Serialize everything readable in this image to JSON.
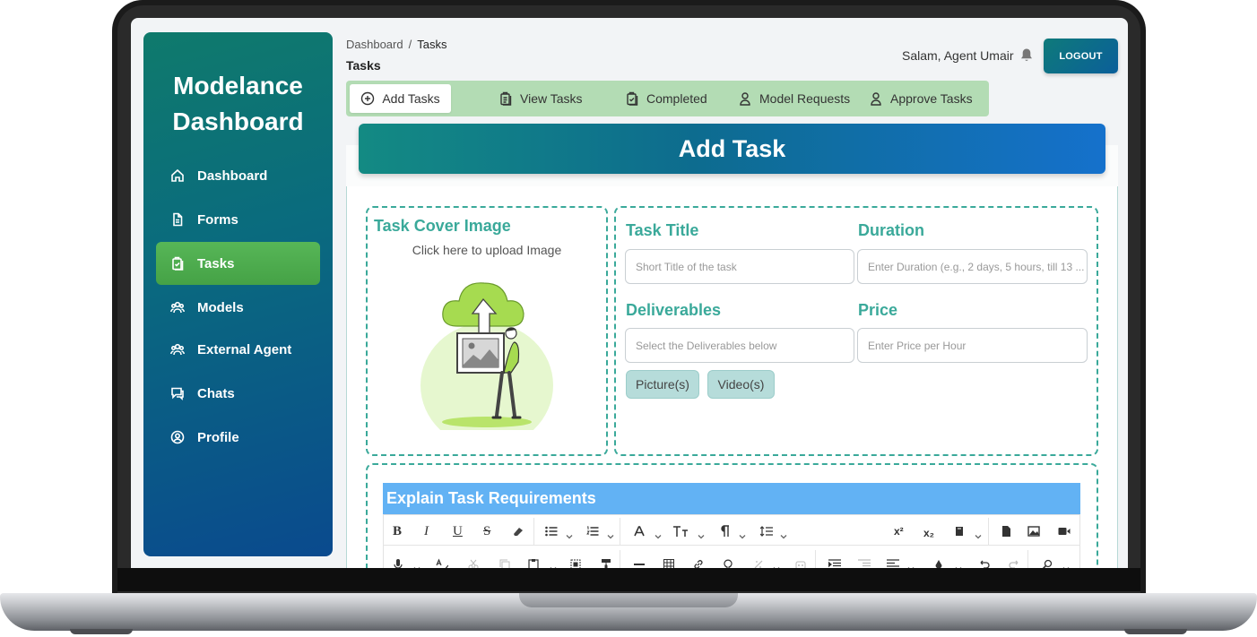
{
  "sidebar": {
    "brand_line1": "Modelance",
    "brand_line2": "Dashboard",
    "items": [
      {
        "label": "Dashboard",
        "icon": "home-icon"
      },
      {
        "label": "Forms",
        "icon": "document-icon"
      },
      {
        "label": "Tasks",
        "icon": "clipboard-check-icon",
        "active": true
      },
      {
        "label": "Models",
        "icon": "users-icon"
      },
      {
        "label": "External Agent",
        "icon": "users-icon"
      },
      {
        "label": "Chats",
        "icon": "chat-icon"
      },
      {
        "label": "Profile",
        "icon": "user-circle-icon"
      }
    ]
  },
  "header": {
    "breadcrumb_root": "Dashboard",
    "breadcrumb_sep": "/",
    "breadcrumb_current": "Tasks",
    "page_title": "Tasks",
    "greeting": "Salam, Agent Umair",
    "logout_label": "LOGOUT"
  },
  "tabs": [
    {
      "label": "Add Tasks",
      "icon": "plus-circle-icon",
      "active": true
    },
    {
      "label": "View Tasks",
      "icon": "clipboard-list-icon"
    },
    {
      "label": "Completed",
      "icon": "clipboard-check-icon"
    },
    {
      "label": "Model Requests",
      "icon": "user-icon"
    },
    {
      "label": "Approve Tasks",
      "icon": "user-icon"
    }
  ],
  "form": {
    "title": "Add Task",
    "cover": {
      "label": "Task Cover Image",
      "hint": "Click here to upload Image"
    },
    "task_title": {
      "label": "Task Title",
      "placeholder": "Short Title of the task"
    },
    "duration": {
      "label": "Duration",
      "placeholder": "Enter Duration (e.g., 2 days, 5 hours, till 13 ..."
    },
    "deliverables": {
      "label": "Deliverables",
      "placeholder": "Select the Deliverables below"
    },
    "price": {
      "label": "Price",
      "placeholder": "Enter Price per Hour"
    },
    "chips": [
      "Picture(s)",
      "Video(s)"
    ],
    "requirements_label": "Explain Task Requirements"
  },
  "editor_toolbar": {
    "bold": "B",
    "italic": "I",
    "underline": "U",
    "strike": "S",
    "superscript": "x²",
    "subscript": "x₂"
  },
  "colors": {
    "accent_teal": "#3aa99a",
    "active_green": "#4caf50",
    "header_blue": "#1571cc",
    "requirements_blue": "#62b2f4"
  }
}
